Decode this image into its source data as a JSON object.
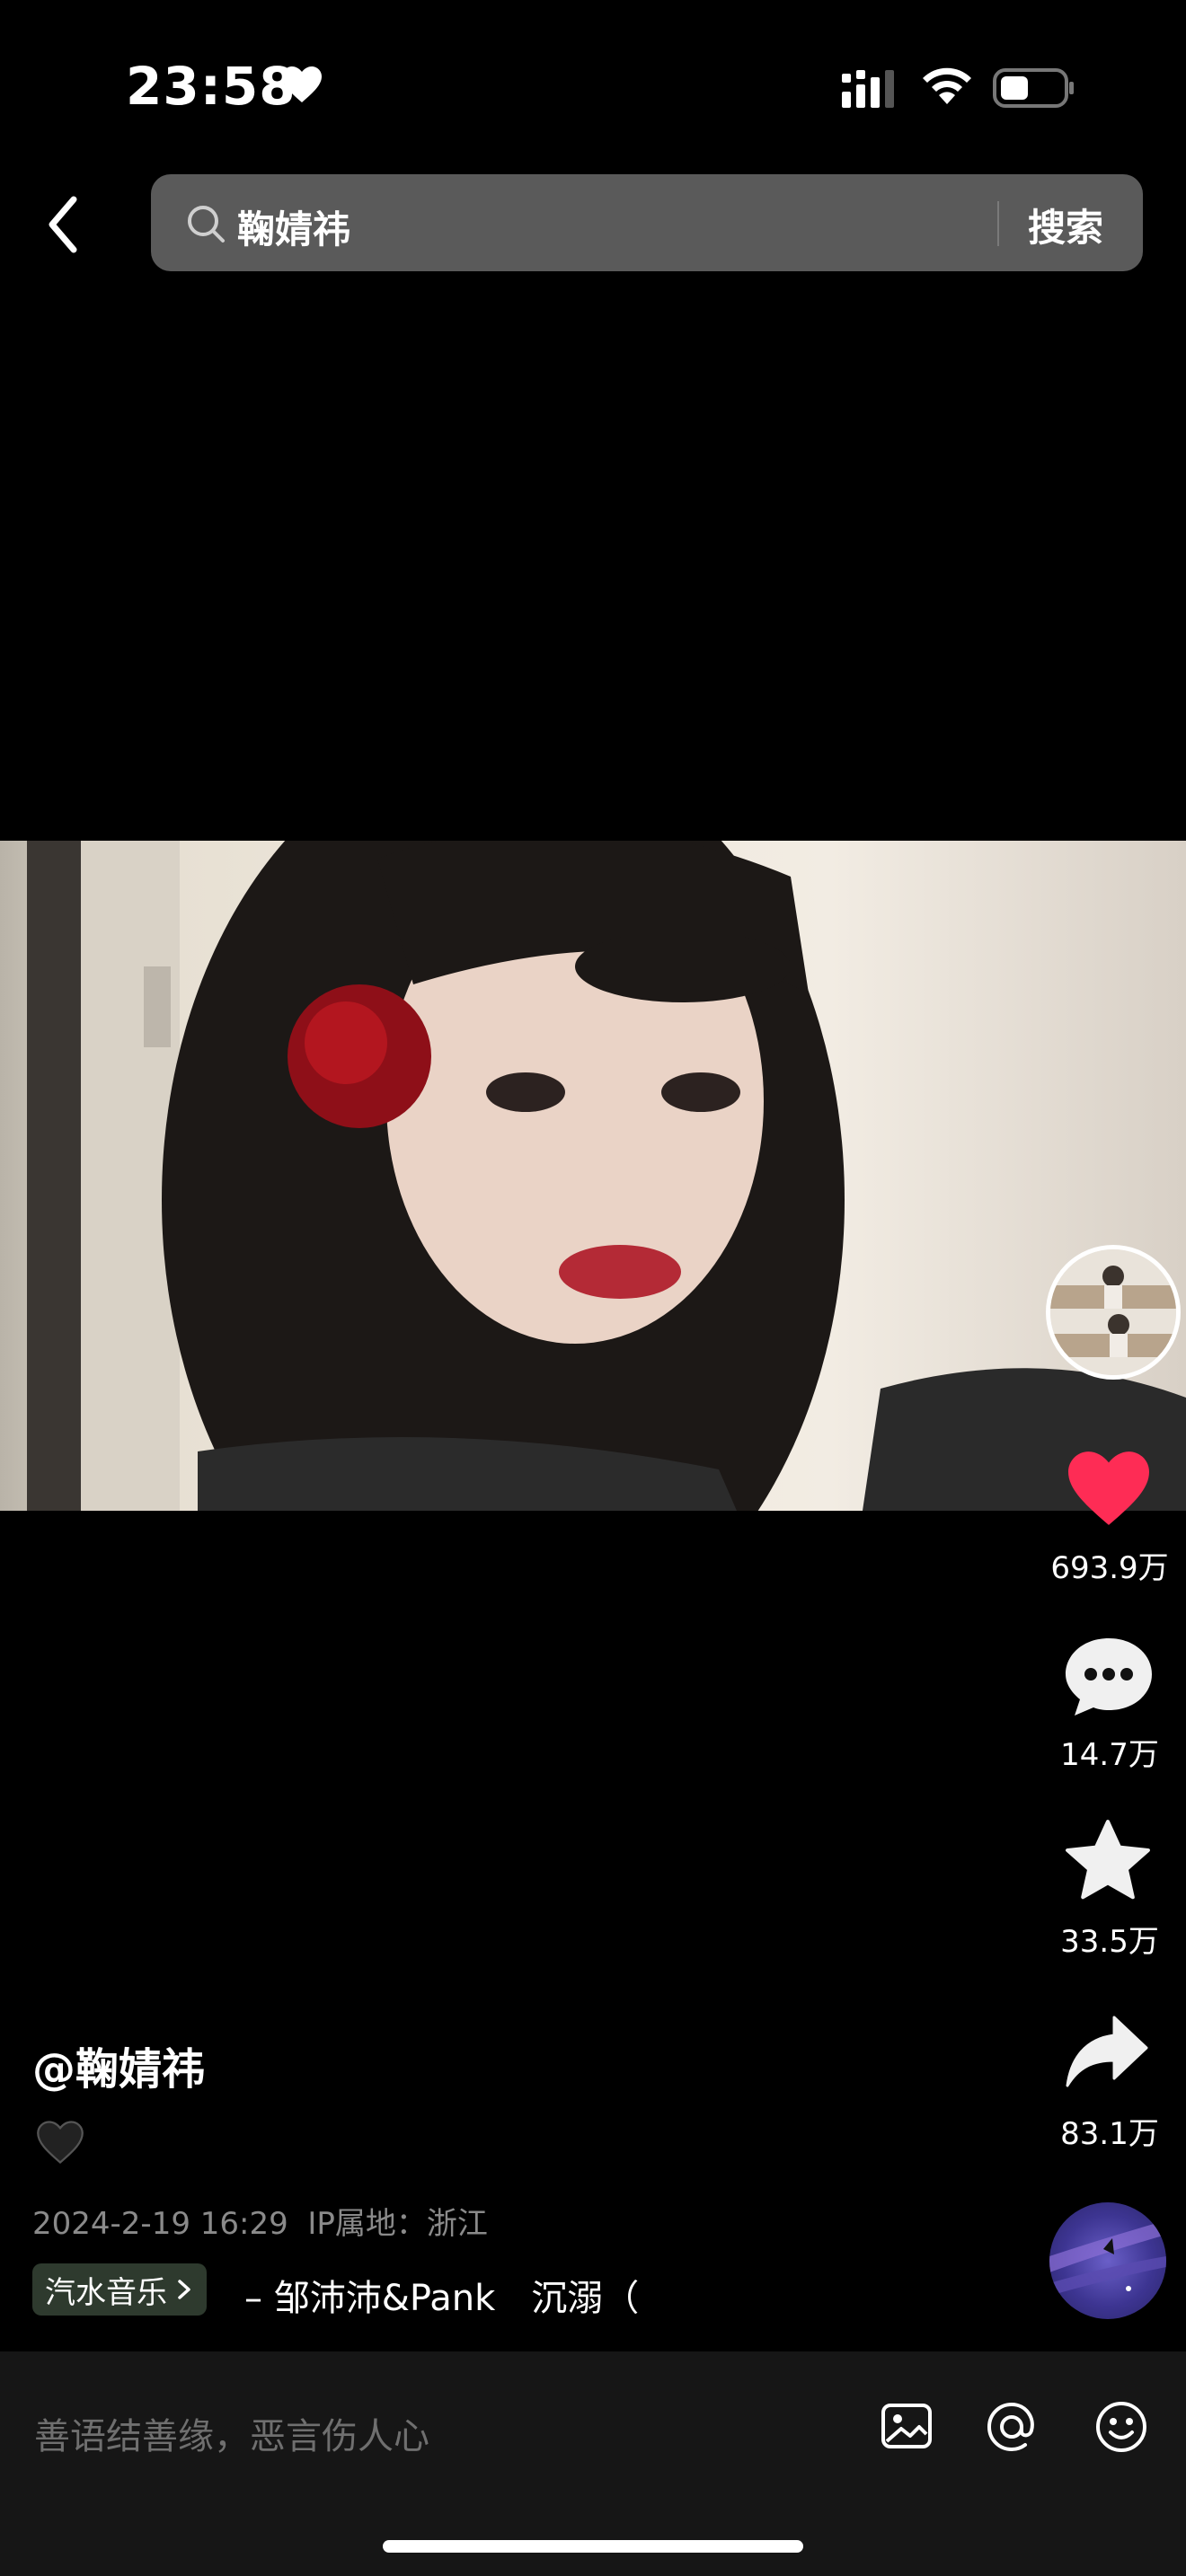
{
  "status_bar": {
    "time": "23:58"
  },
  "search": {
    "query": "鞠婧祎",
    "button_label": "搜索"
  },
  "video": {
    "author": "@鞠婧祎",
    "caption_emoji": "🖤",
    "date": "2024-2-19 16:29",
    "ip_location": "IP属地：浙江",
    "music_tag": "汽水音乐",
    "music_line": "– 邹沛沛&Pank　沉溺（"
  },
  "actions": {
    "likes": "693.9万",
    "comments": "14.7万",
    "favorites": "33.5万",
    "shares": "83.1万"
  },
  "comment_input": {
    "placeholder": "善语结善缘，恶言伤人心"
  },
  "colors": {
    "like": "#fe2c55",
    "background": "#000000",
    "search_bg": "#5a5a5a"
  }
}
